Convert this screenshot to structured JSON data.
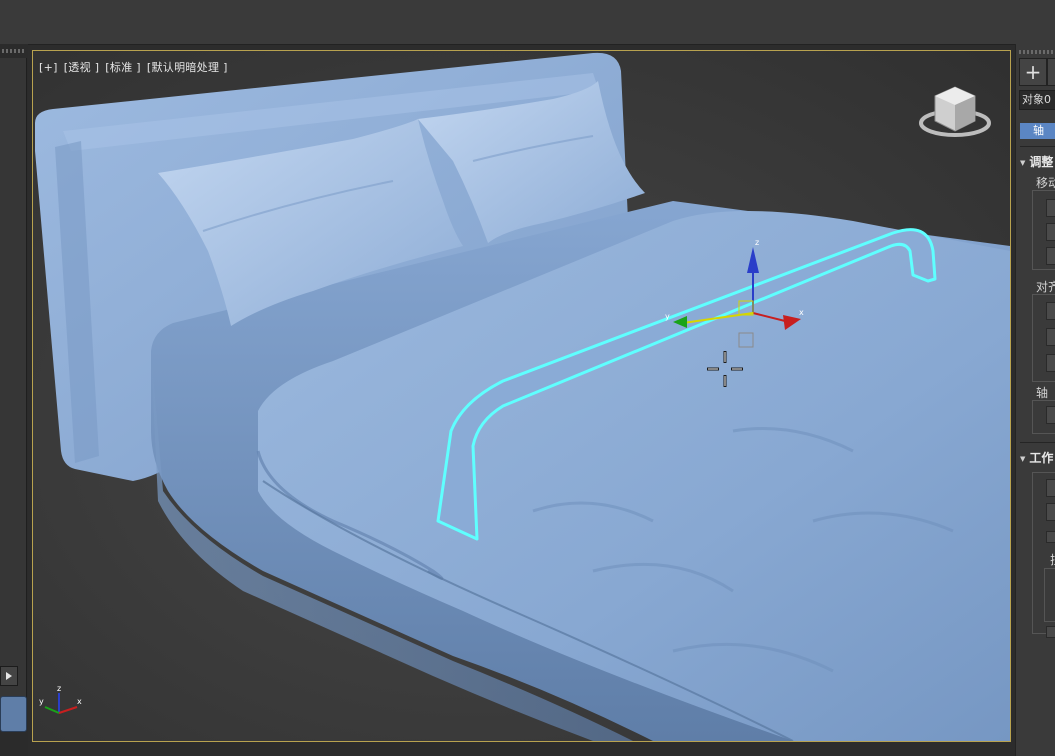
{
  "viewport": {
    "plus": "[+]",
    "view_mode": "[透视 ]",
    "shading": "[标准 ]",
    "lighting": "[默认明暗处理 ]"
  },
  "gizmo": {
    "x": "x",
    "y": "y",
    "z": "z"
  },
  "axis_tripod": {
    "x": "x",
    "y": "y",
    "z": "z"
  },
  "command_panel": {
    "plus_icon": "+",
    "object_name": "对象0",
    "axis_button": "轴",
    "section_adjust": "调整",
    "move_label": "移动",
    "align_label": "对齐",
    "axis_label": "轴",
    "section_work": "工作",
    "sub_label": "拉"
  },
  "colors": {
    "viewport_border": "#b8a24f",
    "selection_outline": "#5fffff",
    "model": "#8fb0d8",
    "accent_button": "#5b86c4"
  }
}
